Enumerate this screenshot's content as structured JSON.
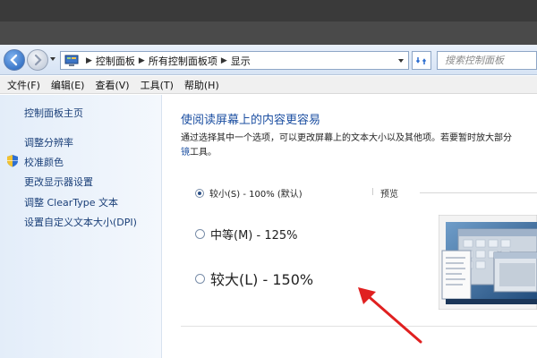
{
  "address": {
    "crumbs": [
      "控制面板",
      "所有控制面板项",
      "显示"
    ]
  },
  "search": {
    "placeholder": "搜索控制面板"
  },
  "menu": [
    "文件(F)",
    "编辑(E)",
    "查看(V)",
    "工具(T)",
    "帮助(H)"
  ],
  "sidebar": {
    "items": [
      "控制面板主页",
      "调整分辨率",
      "校准颜色",
      "更改显示器设置",
      "调整 ClearType 文本",
      "设置自定义文本大小(DPI)"
    ]
  },
  "main": {
    "title": "使阅读屏幕上的内容更容易",
    "desc_line1": "通过选择其中一个选项，可以更改屏幕上的文本大小以及其他项。若要暂时放大部分",
    "desc_link": "镜",
    "desc_line2_rest": "工具。",
    "options": [
      {
        "label": "较小(S) - 100% (默认)",
        "selected": true
      },
      {
        "label": "中等(M) - 125%",
        "selected": false
      },
      {
        "label": "较大(L) - 150%",
        "selected": false
      }
    ],
    "preview_label": "预览"
  },
  "colors": {
    "link": "#1a3f78",
    "title": "#1d50a2",
    "annotation_arrow": "#e02020"
  }
}
